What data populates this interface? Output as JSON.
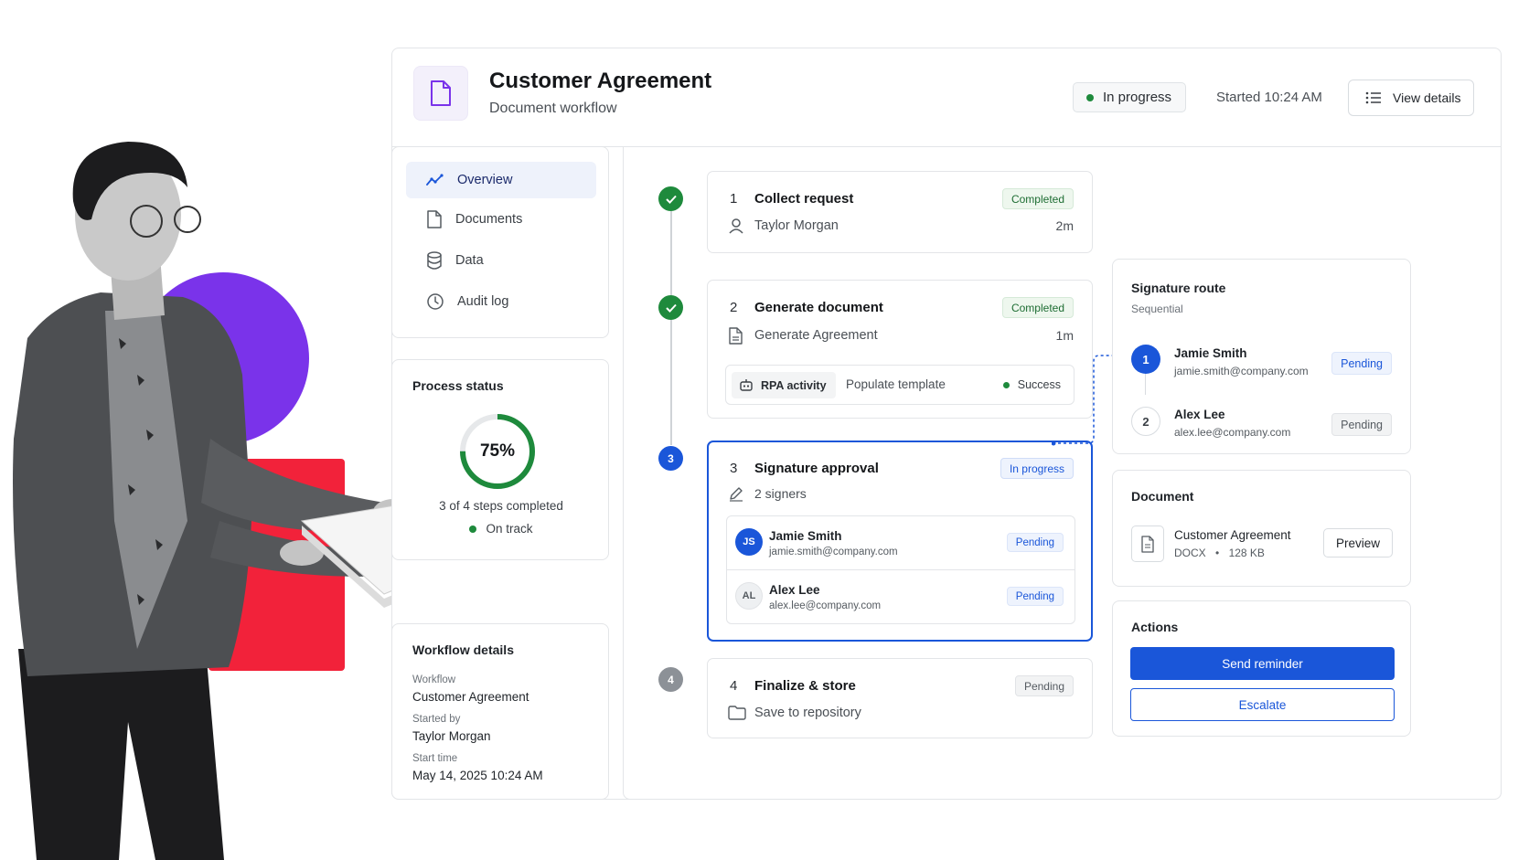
{
  "header": {
    "title": "Customer Agreement",
    "subtitle": "Document workflow",
    "status": "In progress",
    "started": "Started 10:24 AM",
    "view_details": "View details"
  },
  "nav": {
    "items": [
      {
        "label": "Overview",
        "icon": "trend-line-icon",
        "active": true
      },
      {
        "label": "Documents",
        "icon": "document-icon",
        "active": false
      },
      {
        "label": "Data",
        "icon": "database-icon",
        "active": false
      },
      {
        "label": "Audit log",
        "icon": "clock-icon",
        "active": false
      }
    ]
  },
  "process_status": {
    "heading": "Process status",
    "percent_label": "75%",
    "percent": 75,
    "steps_text": "3 of 4 steps completed",
    "health": "On track"
  },
  "workflow_details": {
    "heading": "Workflow details",
    "fields": [
      {
        "label": "Workflow",
        "value": "Customer Agreement"
      },
      {
        "label": "Started by",
        "value": "Taylor Morgan"
      },
      {
        "label": "Start time",
        "value": "May 14, 2025 10:24 AM"
      }
    ]
  },
  "steps": [
    {
      "num": "1",
      "title": "Collect request",
      "status": "Completed",
      "sub": "Taylor Morgan",
      "duration": "2m"
    },
    {
      "num": "2",
      "title": "Generate document",
      "status": "Completed",
      "sub": "Generate Agreement",
      "duration": "1m",
      "activity": {
        "tag": "RPA activity",
        "text": "Populate template",
        "result": "Success"
      }
    },
    {
      "num": "3",
      "title": "Signature approval",
      "status": "In progress",
      "sub": "2 signers",
      "signers": [
        {
          "initials": "JS",
          "name": "Jamie Smith",
          "email": "jamie.smith@company.com",
          "status": "Pending"
        },
        {
          "initials": "AL",
          "name": "Alex Lee",
          "email": "alex.lee@company.com",
          "status": "Pending"
        }
      ]
    },
    {
      "num": "4",
      "title": "Finalize & store",
      "status": "Pending",
      "sub": "Save to repository"
    }
  ],
  "signature_route": {
    "heading": "Signature route",
    "mode": "Sequential",
    "signers": [
      {
        "order": "1",
        "name": "Jamie Smith",
        "email": "jamie.smith@company.com",
        "status": "Pending"
      },
      {
        "order": "2",
        "name": "Alex Lee",
        "email": "alex.lee@company.com",
        "status": "Pending"
      }
    ]
  },
  "document": {
    "heading": "Document",
    "name": "Customer Agreement",
    "type": "DOCX",
    "size": "128 KB",
    "preview": "Preview"
  },
  "actions": {
    "heading": "Actions",
    "primary": "Send reminder",
    "secondary": "Escalate"
  },
  "colors": {
    "accent": "#1a56d9",
    "success": "#1e8a3c",
    "purple_circle": "#7a33ea",
    "red_block": "#f2223a"
  }
}
